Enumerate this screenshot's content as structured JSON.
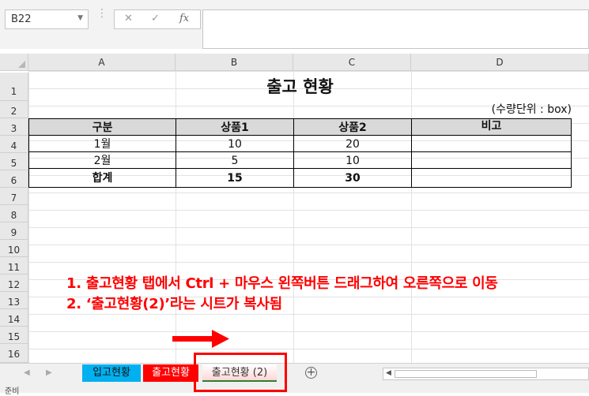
{
  "formula_bar": {
    "name_box": "B22",
    "cancel_icon": "✕",
    "enter_icon": "✓",
    "fx_icon": "fx",
    "formula": ""
  },
  "columns": [
    "A",
    "B",
    "C",
    "D"
  ],
  "rows": [
    "1",
    "2",
    "3",
    "4",
    "5",
    "6",
    "7",
    "8",
    "9",
    "10",
    "11",
    "12",
    "13",
    "14",
    "15",
    "16"
  ],
  "sheet": {
    "title": "출고 현황",
    "unit": "(수량단위 : box)",
    "headers": [
      "구분",
      "상품1",
      "상품2",
      "비고"
    ],
    "data": [
      [
        "1월",
        "10",
        "20",
        ""
      ],
      [
        "2월",
        "5",
        "10",
        ""
      ],
      [
        "합계",
        "15",
        "30",
        ""
      ]
    ]
  },
  "annotations": {
    "line1": "1. 출고현황 탭에서 Ctrl + 마우스 왼쪽버튼 드래그하여 오른쪽으로 이동",
    "line2": "2. ‘출고현황(2)’라는 시트가 복사됨",
    "color": "#ff0000"
  },
  "tabs": [
    {
      "label": "입고현황",
      "color": "#00b0f0"
    },
    {
      "label": "출고현황",
      "color": "#ff0000"
    },
    {
      "label": "출고현황 (2)",
      "color": "#ffd6d6"
    }
  ],
  "icons": {
    "add_sheet": "plus-circle-icon",
    "scroll_left": "triangle-left-icon"
  },
  "status_bar": {
    "mode": "준비"
  }
}
